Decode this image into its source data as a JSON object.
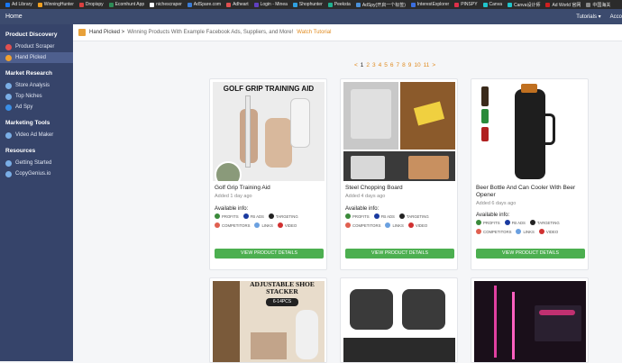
{
  "bookmarks": [
    {
      "label": "Ad Library",
      "color": "#1877f2"
    },
    {
      "label": "WinningHunter",
      "color": "#f0a020"
    },
    {
      "label": "Dropispy",
      "color": "#d94040"
    },
    {
      "label": "Ecomhunt App",
      "color": "#2e8b57"
    },
    {
      "label": "nichescraper",
      "color": "#ffffff"
    },
    {
      "label": "AdSpare.com",
      "color": "#3b7dd8"
    },
    {
      "label": "Adheart",
      "color": "#e05050"
    },
    {
      "label": "Login - Minea",
      "color": "#6040c0"
    },
    {
      "label": "Shophunter",
      "color": "#30a0e0"
    },
    {
      "label": "Peeksta",
      "color": "#20b090"
    },
    {
      "label": "AdSpy(开启一个标签)",
      "color": "#4a90d9"
    },
    {
      "label": "InterestExplorer",
      "color": "#3a6ee0"
    },
    {
      "label": "PINSPY",
      "color": "#e0304a"
    },
    {
      "label": "Canva",
      "color": "#20c4cb"
    },
    {
      "label": "Canva设计师",
      "color": "#20c4cb"
    },
    {
      "label": "Ad World 官网",
      "color": "#d02020"
    },
    {
      "label": "中国海关",
      "color": "#888888"
    }
  ],
  "topnav": {
    "home": "Home",
    "tutorials": "Tutorials ▾",
    "account": "Acco"
  },
  "sidebar": {
    "sections": [
      {
        "title": "Product Discovery",
        "items": [
          {
            "label": "Product Scraper",
            "icon_color": "#e05050",
            "active": false
          },
          {
            "label": "Hand Picked",
            "icon_color": "#f0a030",
            "active": true
          }
        ]
      },
      {
        "title": "Market Research",
        "items": [
          {
            "label": "Store Analysis",
            "icon_color": "#7aaee6",
            "active": false
          },
          {
            "label": "Top Niches",
            "icon_color": "#7aaee6",
            "active": false
          },
          {
            "label": "Ad Spy",
            "icon_color": "#3a8ee6",
            "active": false
          }
        ]
      },
      {
        "title": "Marketing Tools",
        "items": [
          {
            "label": "Video Ad Maker",
            "icon_color": "#7aaee6",
            "active": false
          }
        ]
      },
      {
        "title": "Resources",
        "items": [
          {
            "label": "Getting Started",
            "icon_color": "#7aaee6",
            "active": false
          },
          {
            "label": "CopyGenius.io",
            "icon_color": "#7aaee6",
            "active": false
          }
        ]
      }
    ]
  },
  "breadcrumb": {
    "section": "Hand Picked >",
    "description": "Winning Products With Example Facebook Ads, Suppliers, and More!",
    "link": "Watch Tutorial"
  },
  "pagination": {
    "prev": "<",
    "pages": [
      "1",
      "2",
      "3",
      "4",
      "5",
      "6",
      "7",
      "8",
      "9",
      "10",
      "11"
    ],
    "next": ">",
    "current": "1"
  },
  "products": [
    {
      "title": "Golf Grip Training Aid",
      "added": "Added 1 day ago",
      "image_caption": "GOLF GRIP TRAINING AID"
    },
    {
      "title": "Steel Chopping Board",
      "added": "Added 4 days ago",
      "image_caption": ""
    },
    {
      "title": "Beer Bottle And Can Cooler With Beer Opener",
      "added": "Added 6 days ago",
      "image_caption": ""
    }
  ],
  "second_row": [
    {
      "image_caption": "ADJUSTABLE SHOE STACKER",
      "badge": "6-14PCS"
    },
    {
      "image_caption": ""
    },
    {
      "image_caption": ""
    }
  ],
  "available_label": "Available info:",
  "tags": [
    {
      "label": "PROFITS",
      "color": "#3a8a3a"
    },
    {
      "label": "FB ADS",
      "color": "#1a3aa0"
    },
    {
      "label": "TARGETING",
      "color": "#222222"
    },
    {
      "label": "COMPETITORS",
      "color": "#e06050"
    },
    {
      "label": "LINKS",
      "color": "#6aa0e0"
    },
    {
      "label": "VIDEO",
      "color": "#d03030"
    }
  ],
  "button_label": "VIEW PRODUCT DETAILS"
}
